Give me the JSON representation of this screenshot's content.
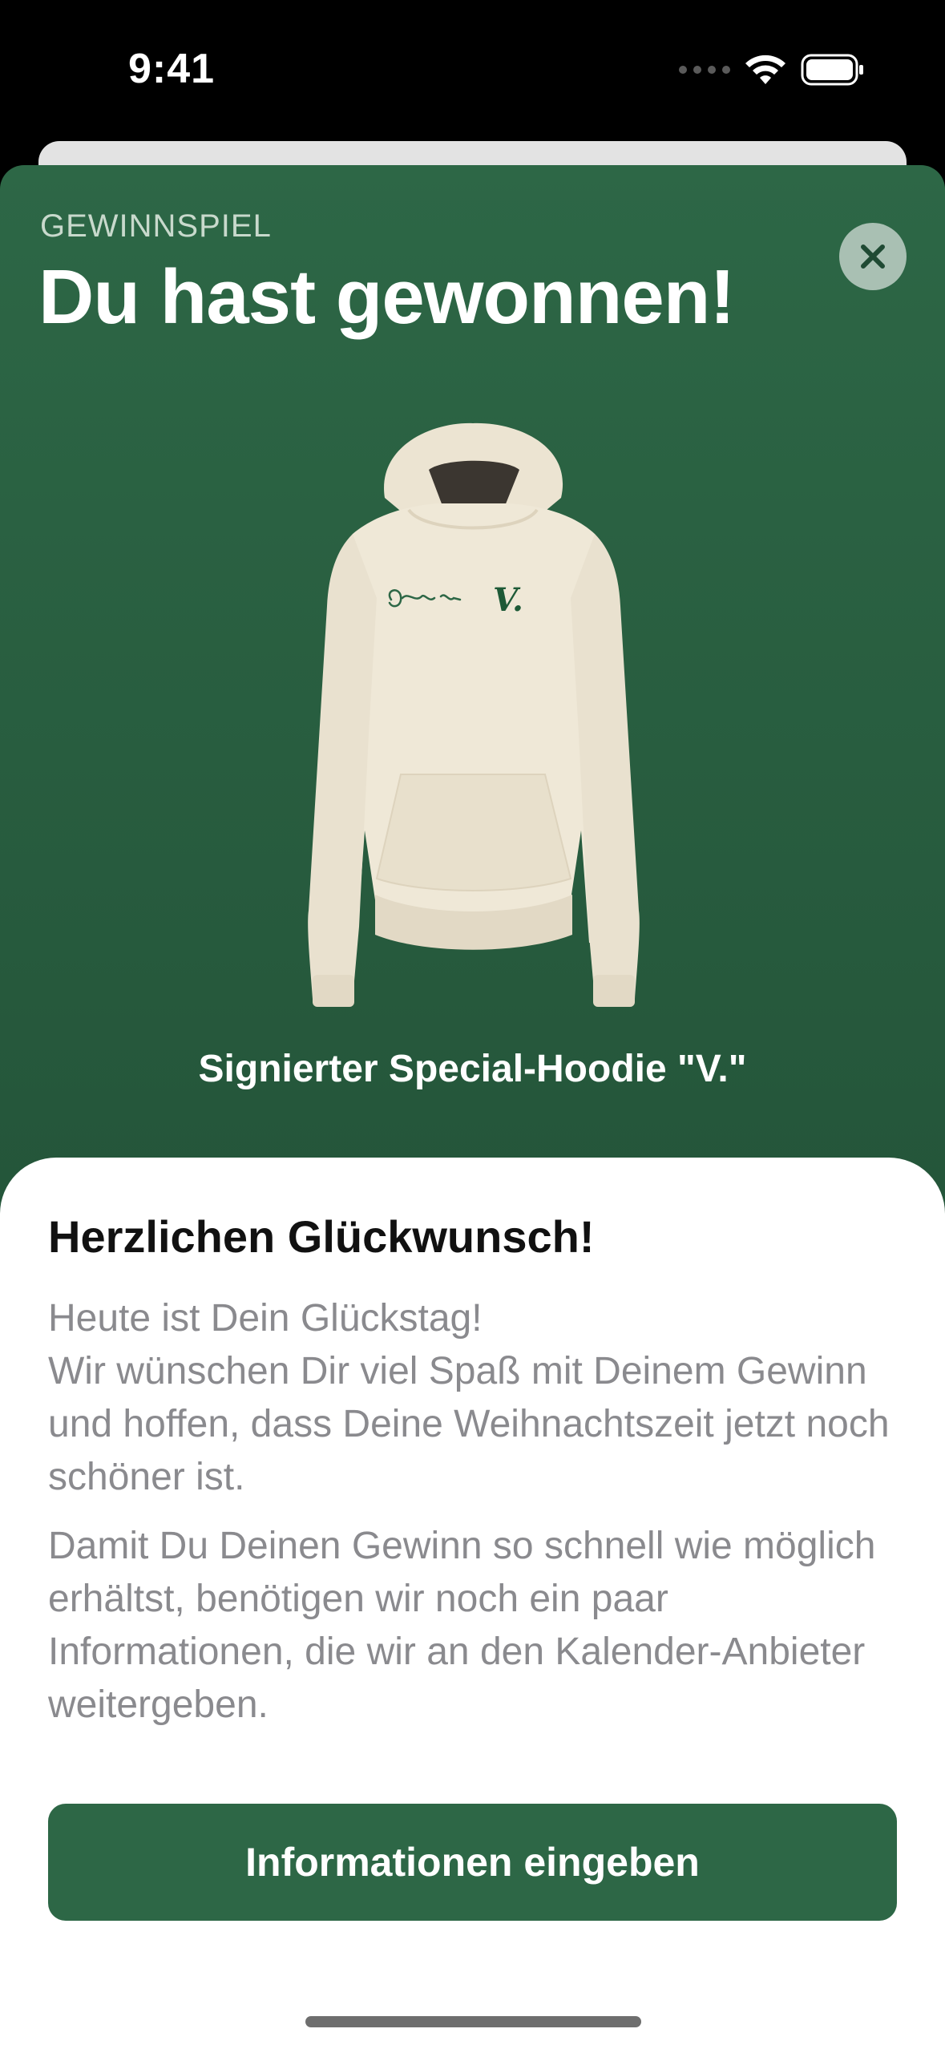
{
  "status_bar": {
    "time": "9:41"
  },
  "modal": {
    "eyebrow": "GEWINNSPIEL",
    "headline": "Du hast gewonnen!",
    "close_icon": "close-icon",
    "product": {
      "name": "Signierter Special-Hoodie \"V.\"",
      "image_icon": "hoodie-image",
      "logo_text": "V."
    }
  },
  "card": {
    "title": "Herzlichen Glückwunsch!",
    "paragraph_1": "Heute ist Dein Glückstag!\nWir wünschen Dir viel Spaß mit Deinem Gewinn und hoffen, dass Deine Weihnachtszeit jetzt noch schöner ist.",
    "paragraph_2": "Damit Du Deinen Gewinn so schnell wie möglich erhältst, benötigen wir noch ein paar Informationen, die wir an den Kalender-Anbieter weitergeben.",
    "cta_label": "Informationen eingeben"
  },
  "colors": {
    "brand_green": "#2d6746",
    "close_bg": "#a9c0b3"
  }
}
